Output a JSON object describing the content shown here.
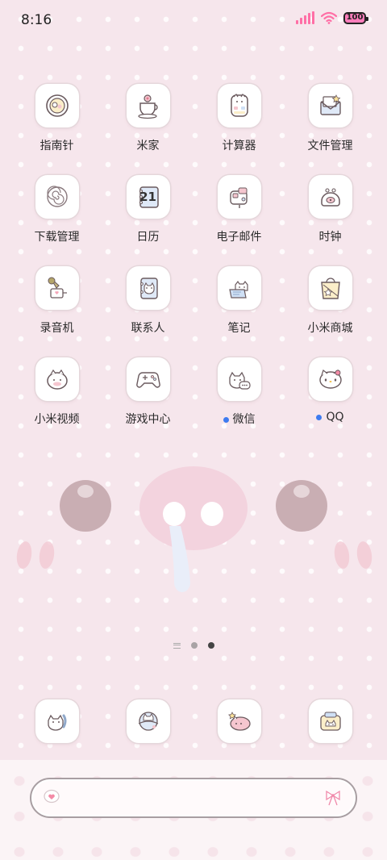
{
  "status_bar": {
    "time": "8:16",
    "battery": "100",
    "accent": "#ff6fa6"
  },
  "apps": [
    {
      "label": "指南针",
      "icon": "compass-icon"
    },
    {
      "label": "米家",
      "icon": "mijia-icon"
    },
    {
      "label": "计算器",
      "icon": "calculator-icon"
    },
    {
      "label": "文件管理",
      "icon": "file-manager-icon"
    },
    {
      "label": "下载管理",
      "icon": "download-manager-icon"
    },
    {
      "label": "日历",
      "icon": "calendar-icon",
      "badge": "21"
    },
    {
      "label": "电子邮件",
      "icon": "email-icon"
    },
    {
      "label": "时钟",
      "icon": "clock-icon"
    },
    {
      "label": "录音机",
      "icon": "recorder-icon"
    },
    {
      "label": "联系人",
      "icon": "contacts-icon"
    },
    {
      "label": "笔记",
      "icon": "notes-icon"
    },
    {
      "label": "小米商城",
      "icon": "mi-store-icon"
    },
    {
      "label": "小米视频",
      "icon": "mi-video-icon"
    },
    {
      "label": "游戏中心",
      "icon": "game-center-icon"
    },
    {
      "label": "微信",
      "icon": "wechat-icon",
      "new": true
    },
    {
      "label": "QQ",
      "icon": "qq-icon",
      "new": true
    }
  ],
  "dock": [
    {
      "icon": "phone-icon"
    },
    {
      "icon": "messages-icon"
    },
    {
      "icon": "browser-icon"
    },
    {
      "icon": "camera-icon"
    }
  ],
  "page_indicator": {
    "pages": 2,
    "active": 2
  },
  "search_bar": {
    "left_icon": "heart-bubble-icon",
    "right_icon": "bow-icon"
  },
  "colors": {
    "background": "#f6e6ec",
    "new_dot": "#3d7bf0",
    "blush": "#f3c9d3"
  }
}
